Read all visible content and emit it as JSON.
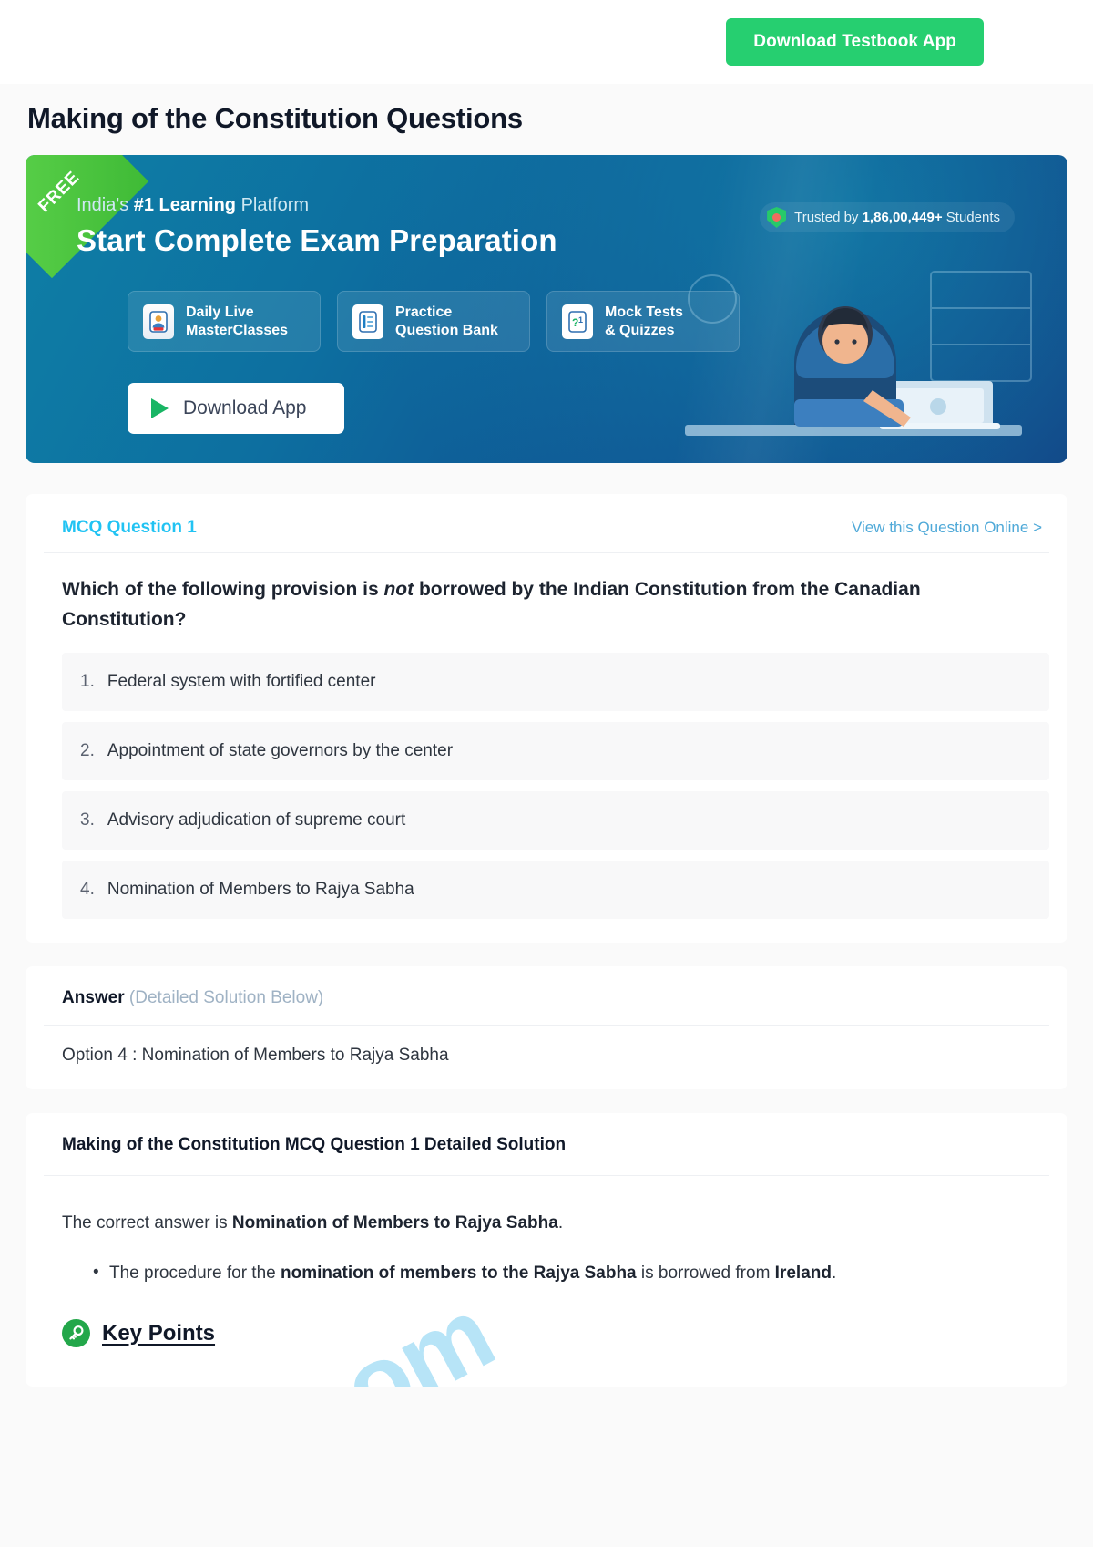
{
  "topbar": {
    "download_app_label": "Download Testbook App"
  },
  "page": {
    "title": "Making of the Constitution Questions"
  },
  "banner": {
    "ribbon_label": "FREE",
    "tagline_prefix": "India's ",
    "tagline_bold": "#1 Learning",
    "tagline_suffix": " Platform",
    "headline": "Start Complete Exam Preparation",
    "trusted_prefix": "Trusted by ",
    "trusted_count": "1,86,00,449+",
    "trusted_suffix": " Students",
    "features": [
      {
        "icon": "live-class-icon",
        "label": "Daily Live\nMasterClasses"
      },
      {
        "icon": "question-bank-icon",
        "label": "Practice\nQuestion Bank"
      },
      {
        "icon": "mock-test-icon",
        "label": "Mock Tests\n& Quizzes"
      }
    ],
    "app_button_label": "Download App"
  },
  "question": {
    "label": "MCQ Question 1",
    "view_online_label": "View this Question Online >",
    "text_before_italic": "Which of the following provision is ",
    "text_italic": "not",
    "text_after_italic": " borrowed by the Indian Constitution from the Canadian Constitution?",
    "options": [
      {
        "num": "1.",
        "text": "Federal system with fortified center"
      },
      {
        "num": "2.",
        "text": "Appointment of state governors by the center"
      },
      {
        "num": "3.",
        "text": "Advisory adjudication of supreme court"
      },
      {
        "num": "4.",
        "text": "Nomination of Members to Rajya Sabha"
      }
    ]
  },
  "answer": {
    "heading_bold": "Answer",
    "heading_muted": "(Detailed Solution Below)",
    "value": "Option 4 : Nomination of Members to Rajya Sabha"
  },
  "solution": {
    "title": "Making of the Constitution MCQ Question 1 Detailed Solution",
    "intro_prefix": "The correct answer is ",
    "intro_bold": "Nomination of Members to Rajya Sabha",
    "intro_suffix": ".",
    "bullet_prefix": "The procedure for the ",
    "bullet_bold": "nomination of members to the Rajya Sabha",
    "bullet_mid": " is borrowed from ",
    "bullet_bold2": "Ireland",
    "bullet_suffix": ".",
    "keypoints_label": "Key Points",
    "keypoints_icon": "key-icon",
    "watermark": "y.com"
  },
  "colors": {
    "accent_green": "#26cf70",
    "question_label": "#21c3f3",
    "link_blue": "#4fa9d8",
    "banner_from": "#0e7fa6",
    "banner_to": "#123a80",
    "watermark": "#9fdcf5"
  }
}
